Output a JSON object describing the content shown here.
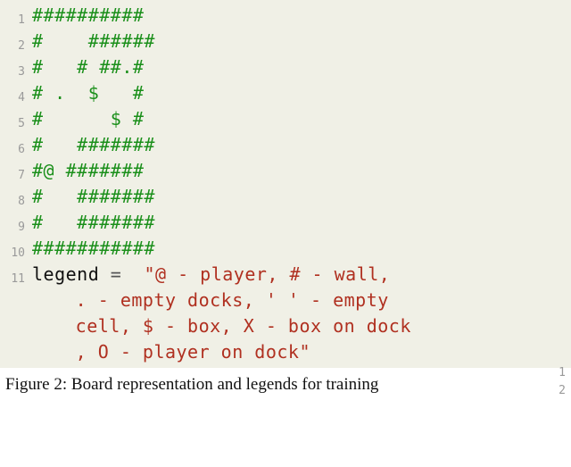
{
  "code_block": {
    "rows": [
      "##########",
      "#    ######",
      "#   # ##.#",
      "# .  $   #",
      "#      $ #",
      "#   #######",
      "#@ #######",
      "#   #######",
      "#   #######",
      "###########"
    ],
    "legend_var": "legend",
    "legend_eq": "=",
    "legend_str_open": "\"",
    "legend_str_body_line1": "@ - player, # - wall,",
    "legend_str_body_line2": " . - empty docks, ' ' - empty",
    "legend_str_body_line3": " cell, $ - box, X - box on dock",
    "legend_str_body_line4": " , O - player on dock",
    "legend_str_close": "\""
  },
  "line_numbers": [
    "1",
    "2",
    "3",
    "4",
    "5",
    "6",
    "7",
    "8",
    "9",
    "10",
    "11"
  ],
  "caption_prefix": "Figure 2: ",
  "caption_rest": "Board representation and legends for training",
  "right_margin_numbers": [
    "1",
    "2"
  ]
}
